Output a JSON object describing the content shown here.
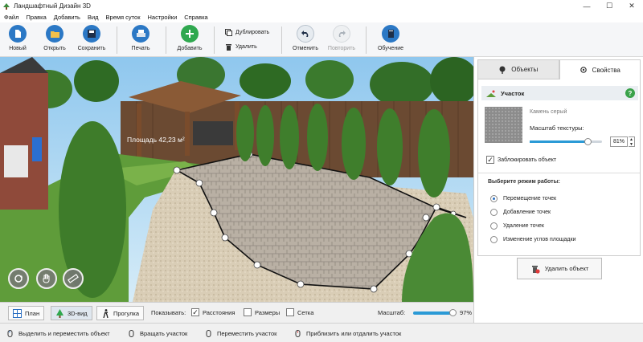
{
  "window": {
    "title": "Ландшафтный Дизайн 3D"
  },
  "menu": [
    "Файл",
    "Правка",
    "Добавить",
    "Вид",
    "Время суток",
    "Настройки",
    "Справка"
  ],
  "toolbar": {
    "new": "Новый",
    "open": "Открыть",
    "save": "Сохранить",
    "print": "Печать",
    "add": "Добавить",
    "duplicate": "Дублировать",
    "delete": "Удалить",
    "undo": "Отменить",
    "redo": "Повторить",
    "tutorial": "Обучение"
  },
  "scene": {
    "area_label": "Площадь 42,23 м²"
  },
  "bottom": {
    "plan": "План",
    "view3d": "3D-вид",
    "walk": "Прогулка",
    "show_label": "Показывать:",
    "distances": "Расстояния",
    "sizes": "Размеры",
    "grid": "Сетка",
    "scale_label": "Масштаб:",
    "scale_value": "97%",
    "scale_fraction": 0.97,
    "distances_checked": true,
    "sizes_checked": false,
    "grid_checked": false
  },
  "status": {
    "s1": "Выделить и переместить объект",
    "s2": "Вращать участок",
    "s3": "Переместить участок",
    "s4": "Приблизить или отдалить участок"
  },
  "panel": {
    "tab_objects": "Объекты",
    "tab_properties": "Свойства",
    "section_title": "Участок",
    "help": "?",
    "material": "Камень серый",
    "texture_scale_label": "Масштаб текстуры:",
    "texture_scale_value": "81%",
    "texture_scale_fraction": 0.81,
    "lock_label": "Заблокировать объект",
    "lock_checked": true,
    "mode_title": "Выберите режим работы:",
    "modes": [
      "Перемещение точек",
      "Добавление точек",
      "Удаление точек",
      "Изменение углов площадки"
    ],
    "selected_mode": 0,
    "delete_button": "Удалить объект"
  },
  "colors": {
    "accent": "#2b78c5",
    "add_green": "#2fa84f",
    "help_green": "#3aa24a",
    "sky": "#a9d3f0"
  }
}
